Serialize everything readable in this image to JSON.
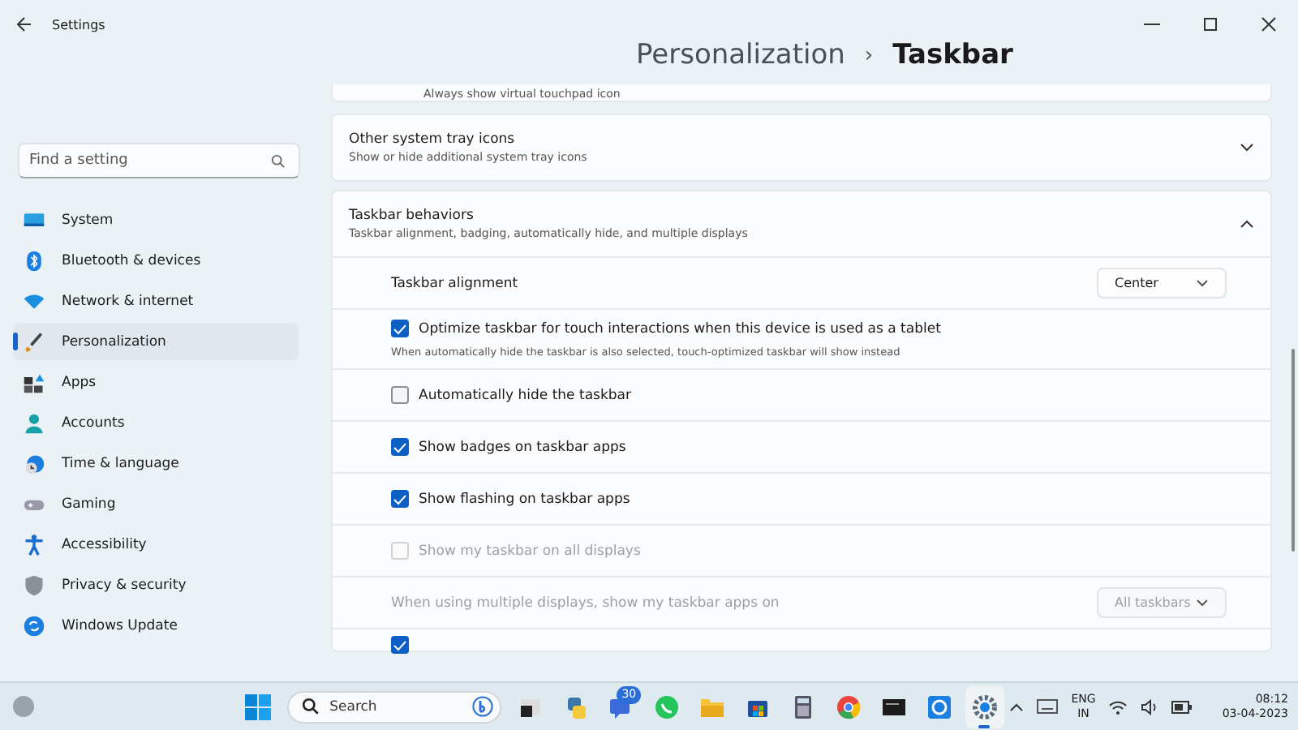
{
  "window": {
    "title": "Settings"
  },
  "search": {
    "placeholder": "Find a setting"
  },
  "nav": [
    {
      "label": "System",
      "selected": false
    },
    {
      "label": "Bluetooth & devices",
      "selected": false
    },
    {
      "label": "Network & internet",
      "selected": false
    },
    {
      "label": "Personalization",
      "selected": true
    },
    {
      "label": "Apps",
      "selected": false
    },
    {
      "label": "Accounts",
      "selected": false
    },
    {
      "label": "Time & language",
      "selected": false
    },
    {
      "label": "Gaming",
      "selected": false
    },
    {
      "label": "Accessibility",
      "selected": false
    },
    {
      "label": "Privacy & security",
      "selected": false
    },
    {
      "label": "Windows Update",
      "selected": false
    }
  ],
  "breadcrumb": {
    "parent": "Personalization",
    "separator": "›",
    "current": "Taskbar"
  },
  "cut_top_text": "Always show virtual touchpad icon",
  "cards": [
    {
      "title": "Other system tray icons",
      "subtitle": "Show or hide additional system tray icons",
      "expanded": false
    },
    {
      "title": "Taskbar behaviors",
      "subtitle": "Taskbar alignment, badging, automatically hide, and multiple displays",
      "expanded": true,
      "rows": [
        {
          "kind": "dropdown",
          "label": "Taskbar alignment",
          "value": "Center",
          "disabled": false
        },
        {
          "kind": "checkbox",
          "label": "Optimize taskbar for touch interactions when this device is used as a tablet",
          "note": "When automatically hide the taskbar is also selected, touch-optimized taskbar will show instead",
          "checked": true,
          "disabled": false
        },
        {
          "kind": "checkbox",
          "label": "Automatically hide the taskbar",
          "checked": false,
          "disabled": false
        },
        {
          "kind": "checkbox",
          "label": "Show badges on taskbar apps",
          "checked": true,
          "disabled": false
        },
        {
          "kind": "checkbox",
          "label": "Show flashing on taskbar apps",
          "checked": true,
          "disabled": false
        },
        {
          "kind": "checkbox",
          "label": "Show my taskbar on all displays",
          "checked": false,
          "disabled": true
        },
        {
          "kind": "dropdown",
          "label": "When using multiple displays, show my taskbar apps on",
          "value": "All taskbars",
          "disabled": true
        },
        {
          "kind": "checkbox",
          "checked": true,
          "disabled": false
        }
      ]
    }
  ],
  "taskbar": {
    "search_placeholder": "Search",
    "apps": [
      {
        "active": false
      },
      {
        "active": false
      },
      {
        "active": false,
        "badge": "30"
      },
      {
        "active": false
      },
      {
        "active": false
      },
      {
        "active": false
      },
      {
        "active": false
      },
      {
        "active": false
      },
      {
        "active": false
      },
      {
        "active": false
      },
      {
        "active": true
      }
    ],
    "language": "ENG",
    "region": "IN",
    "time": "08:12",
    "date": "03-04-2023"
  }
}
